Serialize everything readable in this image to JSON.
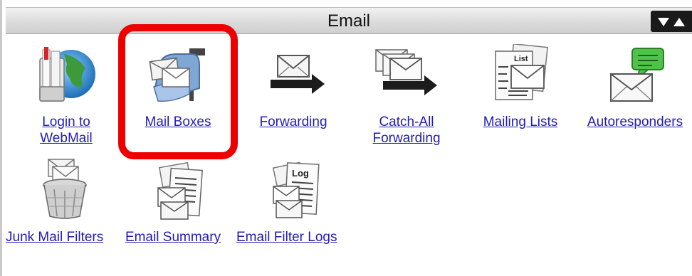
{
  "panel": {
    "title": "Email"
  },
  "items": [
    {
      "id": "login",
      "label_line1": "Login to",
      "label_line2": "WebMail",
      "icon": "webmail-icon"
    },
    {
      "id": "mailboxes",
      "label": "Mail Boxes",
      "icon": "mailbox-icon"
    },
    {
      "id": "forwarding",
      "label": "Forwarding",
      "icon": "forwarding-icon"
    },
    {
      "id": "catchall",
      "label_line1": "Catch-All",
      "label_line2": "Forwarding",
      "icon": "catch-all-icon"
    },
    {
      "id": "mailinglists",
      "label": "Mailing Lists",
      "icon": "mailing-list-icon"
    },
    {
      "id": "autoresponders",
      "label": "Autoresponders",
      "icon": "autoresponder-icon"
    },
    {
      "id": "junk",
      "label": "Junk Mail Filters",
      "icon": "trash-icon"
    },
    {
      "id": "summary",
      "label": "Email Summary",
      "icon": "email-summary-icon"
    },
    {
      "id": "filterlogs",
      "label": "Email Filter Logs",
      "icon": "filter-log-icon"
    }
  ],
  "icon_text": {
    "list": "List",
    "log": "Log"
  },
  "colors": {
    "link": "#221bb5",
    "highlight": "#ee0000",
    "header_toggle": "#1a1a1a"
  }
}
